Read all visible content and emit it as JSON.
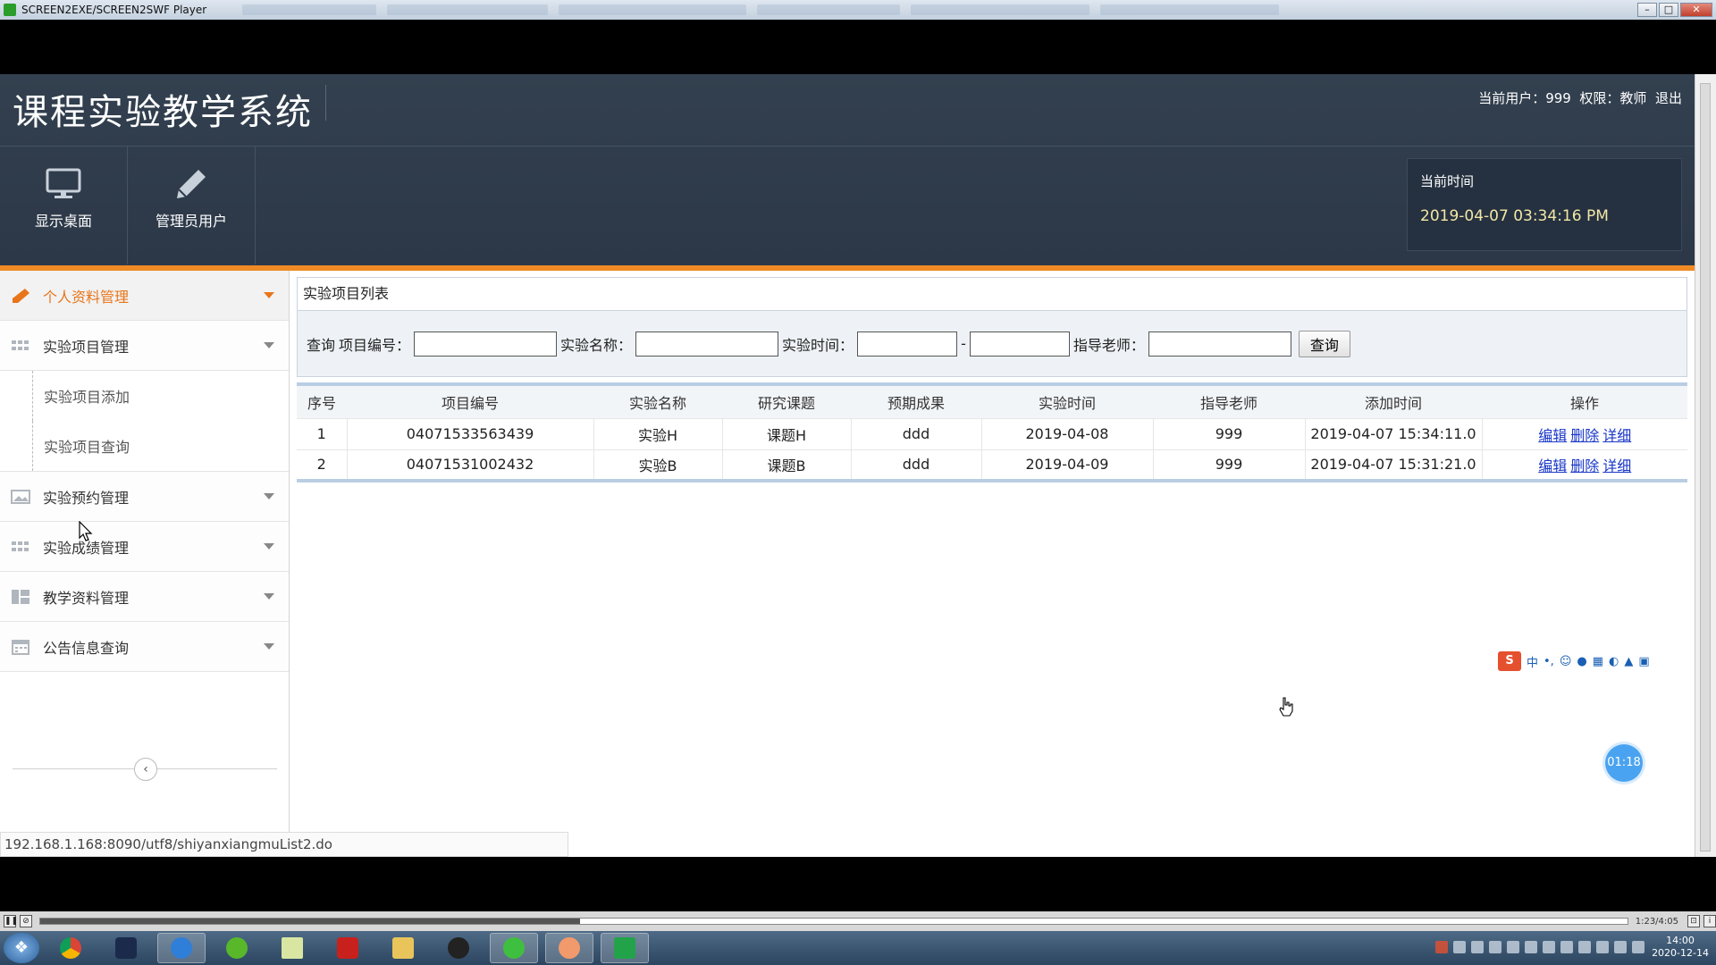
{
  "window": {
    "title": "SCREEN2EXE/SCREEN2SWF Player"
  },
  "header": {
    "title": "课程实验教学系统",
    "user_prefix": "当前用户：",
    "user_name": "999",
    "role_prefix": "权限：",
    "role": "教师",
    "logout": "退出",
    "nav": [
      {
        "label": "显示桌面",
        "icon": "monitor-icon"
      },
      {
        "label": "管理员用户",
        "icon": "pencil-icon"
      }
    ],
    "time_label": "当前时间",
    "time_value": "2019-04-07 03:34:16 PM"
  },
  "sidebar": {
    "menus": [
      {
        "label": "个人资料管理",
        "icon": "pencil-icon",
        "active": true
      },
      {
        "label": "实验项目管理",
        "icon": "grid-icon"
      },
      {
        "label": "实验预约管理",
        "icon": "image-icon"
      },
      {
        "label": "实验成绩管理",
        "icon": "grid-icon"
      },
      {
        "label": "教学资料管理",
        "icon": "layout-icon"
      },
      {
        "label": "公告信息查询",
        "icon": "calendar-icon"
      }
    ],
    "submenu": [
      "实验项目添加",
      "实验项目查询"
    ]
  },
  "panel": {
    "title": "实验项目列表",
    "search": {
      "prefix": "查询",
      "f1_label": "项目编号：",
      "f2_label": "实验名称：",
      "f3_label": "实验时间：",
      "range_sep": "-",
      "f4_label": "指导老师：",
      "button": "查询"
    },
    "table": {
      "headers": [
        "序号",
        "项目编号",
        "实验名称",
        "研究课题",
        "预期成果",
        "实验时间",
        "指导老师",
        "添加时间",
        "操作"
      ],
      "rows": [
        {
          "no": "1",
          "code": "04071533563439",
          "name": "实验H",
          "topic": "课题H",
          "result": "ddd",
          "date": "2019-04-08",
          "teacher": "999",
          "added": "2019-04-07 15:34:11.0"
        },
        {
          "no": "2",
          "code": "04071531002432",
          "name": "实验B",
          "topic": "课题B",
          "result": "ddd",
          "date": "2019-04-09",
          "teacher": "999",
          "added": "2019-04-07 15:31:21.0"
        }
      ],
      "actions": [
        "编辑",
        "删除",
        "详细"
      ]
    }
  },
  "status_url": "192.168.1.168:8090/utf8/shiyanxiangmuList2.do",
  "ime": {
    "logo": "S",
    "mode": "中"
  },
  "timer": "01:18",
  "player": {
    "time": "1:23/4:05",
    "progress": 0.34
  },
  "taskbar": {
    "clock_time": "14:00",
    "clock_date": "2020-12-14"
  },
  "colors": {
    "header_bg": "#2f3b4b",
    "accent_orange": "#f08a24",
    "link_blue": "#1a37c8"
  }
}
